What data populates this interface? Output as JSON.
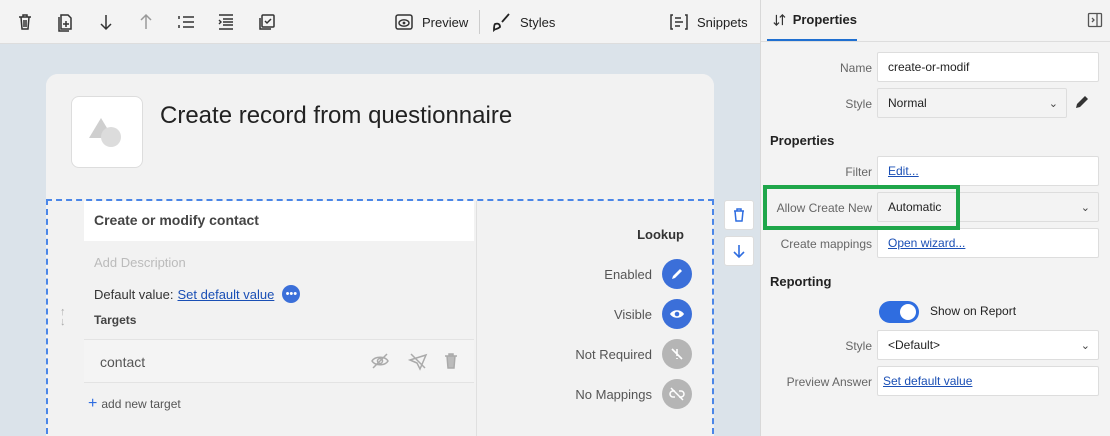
{
  "toolbar": {
    "preview_label": "Preview",
    "styles_label": "Styles",
    "snippets_label": "Snippets"
  },
  "questionnaire": {
    "title": "Create record from questionnaire",
    "question_title": "Create or modify contact",
    "description_placeholder": "Add Description",
    "default_value_label": "Default value:",
    "default_value_link": "Set default value",
    "more_label": "•••",
    "targets_label": "Targets",
    "target_name": "contact",
    "add_target_label": "add new target",
    "lookup_label": "Lookup",
    "options": [
      {
        "label": "Enabled",
        "state": "on"
      },
      {
        "label": "Visible",
        "state": "on"
      },
      {
        "label": "Not Required",
        "state": "off"
      },
      {
        "label": "No Mappings",
        "state": "off"
      }
    ]
  },
  "panel": {
    "tab_label": "Properties",
    "name_label": "Name",
    "name_value": "create-or-modif",
    "style_label": "Style",
    "style_value": "Normal",
    "properties_section": "Properties",
    "filter_label": "Filter",
    "filter_link": "Edit...",
    "allow_create_label": "Allow Create New",
    "allow_create_value": "Automatic",
    "create_mappings_label": "Create mappings",
    "create_mappings_link": "Open wizard...",
    "reporting_section": "Reporting",
    "show_on_report_label": "Show on Report",
    "show_on_report": true,
    "report_style_label": "Style",
    "report_style_value": "<Default>",
    "preview_answer_label": "Preview Answer",
    "preview_answer_link": "Set default value"
  },
  "colors": {
    "accent": "#2f6de0",
    "highlight": "#1fa64a"
  }
}
